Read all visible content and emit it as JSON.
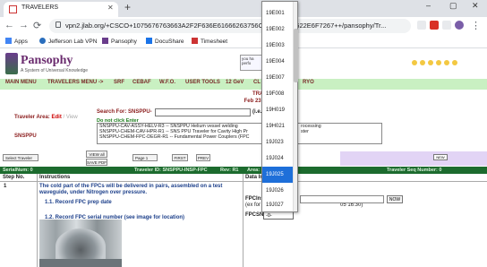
{
  "browser": {
    "tab_title": "TRAVELERS",
    "new_tab": "+",
    "url": "vpn2.jlab.org/+CSCO+1075676763663A2F2F636E61666263756C2E6A6C61622E6F7267++/pansophy/Tr...",
    "window_controls": [
      "–",
      "▢",
      "✕"
    ],
    "bookmarks": [
      "Apps",
      "Jefferson Lab VPN",
      "Pansophy",
      "DocuShare",
      "Timesheet"
    ]
  },
  "header": {
    "logo_title": "Pansophy",
    "logo_subtitle": "A System of Universal Knowledge",
    "box_line1": "you ha",
    "box_line2": "perfo"
  },
  "menu": {
    "items": [
      "MAIN MENU",
      "TRAVELERS MENU ->",
      "SRF",
      "CEBAF",
      "W.F.O.",
      "USER TOOLS",
      "12 GeV",
      "CL",
      "RYO"
    ]
  },
  "page": {
    "heading": "TRAVELERS",
    "date": "Feb 23, 2021 7:34:1",
    "traveler_area_label": "Traveler Area:",
    "edit_label": "Edit",
    "slash": "/",
    "view_label": "View",
    "area_value": "SNSPPU",
    "search_label": "Search For: SNSPPU-",
    "search_value": "",
    "search_hint": "(i.e. CMA-ASSY",
    "no_click_enter": "Do not click Enter",
    "traveler_list": [
      "SNSPPU-CAV-ASSY-HELV-R3 -- SNSPPU Helium vessel welding",
      "SNSPPU-CHEM-CAV-HPR-R1 -- SNS PPU Traveler for Cavity High Pr",
      "SNSPPU-CHEM-FPC-DEGR-R1 -- Fundamental Power Couplers (FPC"
    ],
    "traveler_list_right": [
      "",
      "rocessing",
      "ster"
    ]
  },
  "controls": {
    "select_traveler": "Select Traveler",
    "view_all": "VIEW all",
    "save_pdf": "SAVE PDF",
    "page_select": "Page 1",
    "first": "FIRST",
    "prev": "PREV",
    "new_label": "NEW"
  },
  "serial_bar": {
    "serial": "SerialNum: 0",
    "traveler_id": "Traveler ID: SNSPPU-INSP-FPC",
    "rev": "Rev: R1",
    "area": "Area: SNSPPU",
    "seq": "Traveler Seq Number: 0"
  },
  "table": {
    "col_step": "Step No.",
    "col_instructions": "Instructions",
    "col_data": "Data In",
    "rows": [
      {
        "step": "1",
        "instruction_line1": "The cold part of the FPCs will be delivered in pairs, assembled on a test",
        "instruction_line2": "waveguide, under Nitrogen over pressure."
      }
    ],
    "substep1": "1.1. Record FPC prep date",
    "fpcins_label": "FPCIns",
    "fpcins_hint": "(ex for",
    "fpcins_hint_right": "05 16:30)",
    "now_button": "NOW",
    "substep2": "1.2. Record FPC serial number (see image for location)",
    "fpcsn_label": "FPCSN",
    "fpcsn_value": "-0-"
  },
  "dropdown": {
    "options": [
      "19E001",
      "19E002",
      "19E003",
      "19E004",
      "19E007",
      "19F008",
      "19H019",
      "19H021",
      "19J023",
      "19J024",
      "19J025",
      "19J026",
      "19J027"
    ],
    "selected": "19J025"
  }
}
